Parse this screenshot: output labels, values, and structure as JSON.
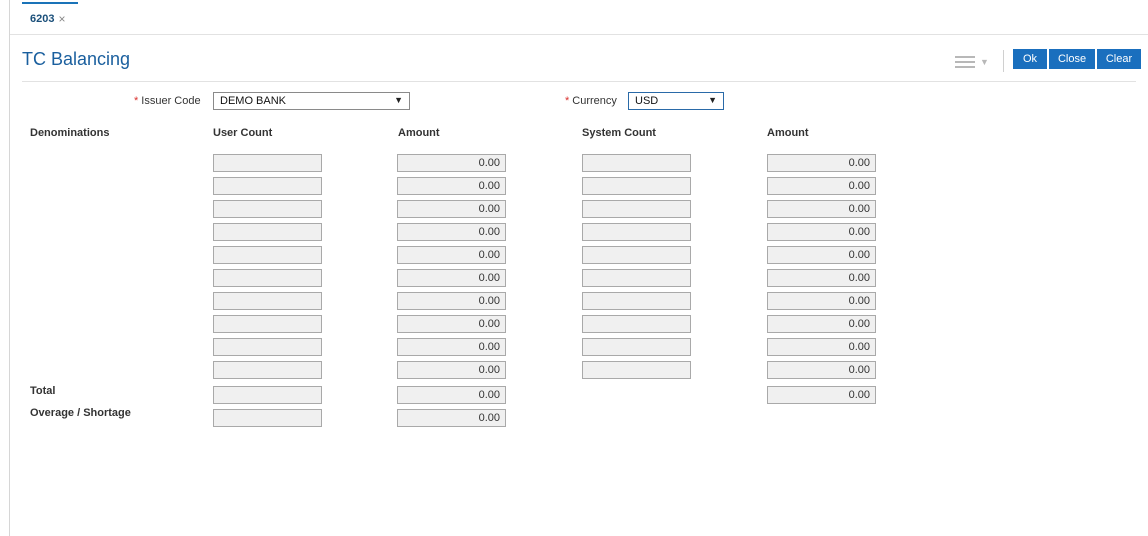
{
  "tab": {
    "label": "6203",
    "close": "×"
  },
  "page": {
    "title": "TC Balancing"
  },
  "toolbar": {
    "ok_label": "Ok",
    "close_label": "Close",
    "clear_label": "Clear",
    "menu_icon": "hamburger-menu-icon"
  },
  "form": {
    "issuer_code": {
      "label": "Issuer Code",
      "value": "DEMO BANK",
      "required": true
    },
    "currency": {
      "label": "Currency",
      "value": "USD",
      "required": true
    }
  },
  "columns": {
    "denominations": "Denominations",
    "user_count": "User Count",
    "user_amount": "Amount",
    "system_count": "System Count",
    "system_amount": "Amount"
  },
  "rows": [
    {
      "user_count": "",
      "user_amount": "0.00",
      "system_count": "",
      "system_amount": "0.00"
    },
    {
      "user_count": "",
      "user_amount": "0.00",
      "system_count": "",
      "system_amount": "0.00"
    },
    {
      "user_count": "",
      "user_amount": "0.00",
      "system_count": "",
      "system_amount": "0.00"
    },
    {
      "user_count": "",
      "user_amount": "0.00",
      "system_count": "",
      "system_amount": "0.00"
    },
    {
      "user_count": "",
      "user_amount": "0.00",
      "system_count": "",
      "system_amount": "0.00"
    },
    {
      "user_count": "",
      "user_amount": "0.00",
      "system_count": "",
      "system_amount": "0.00"
    },
    {
      "user_count": "",
      "user_amount": "0.00",
      "system_count": "",
      "system_amount": "0.00"
    },
    {
      "user_count": "",
      "user_amount": "0.00",
      "system_count": "",
      "system_amount": "0.00"
    },
    {
      "user_count": "",
      "user_amount": "0.00",
      "system_count": "",
      "system_amount": "0.00"
    },
    {
      "user_count": "",
      "user_amount": "0.00",
      "system_count": "",
      "system_amount": "0.00"
    }
  ],
  "total": {
    "label": "Total",
    "user_count": "",
    "user_amount": "0.00",
    "system_amount": "0.00"
  },
  "overage": {
    "label": "Overage / Shortage",
    "user_count": "",
    "user_amount": "0.00"
  },
  "colors": {
    "accent": "#1a6fbe",
    "title": "#1a5f9e",
    "required": "#d9302c",
    "field_bg": "#f0f0f0"
  }
}
